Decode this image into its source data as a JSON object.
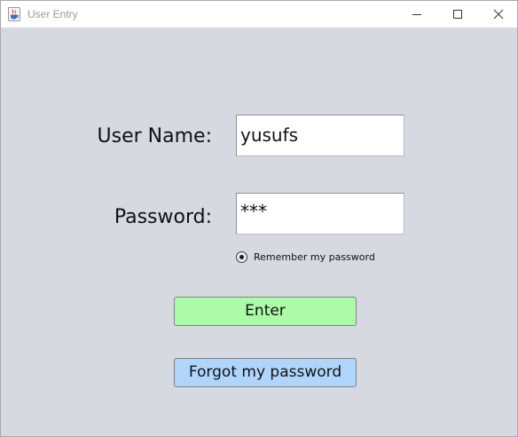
{
  "window": {
    "title": "User Entry",
    "icon": "java-cup-icon",
    "controls": [
      "minimize-icon",
      "maximize-icon",
      "close-icon"
    ]
  },
  "form": {
    "username_label": "User Name:",
    "username_value": "yusufs",
    "password_label": "Password:",
    "password_value": "***",
    "remember_label": "Remember my password",
    "remember_checked": true
  },
  "buttons": {
    "enter_label": "Enter",
    "forgot_label": "Forgot my password"
  },
  "colors": {
    "background": "#d6d9e0",
    "enter_button": "#adfaa9",
    "forgot_button": "#b0d5fb"
  }
}
